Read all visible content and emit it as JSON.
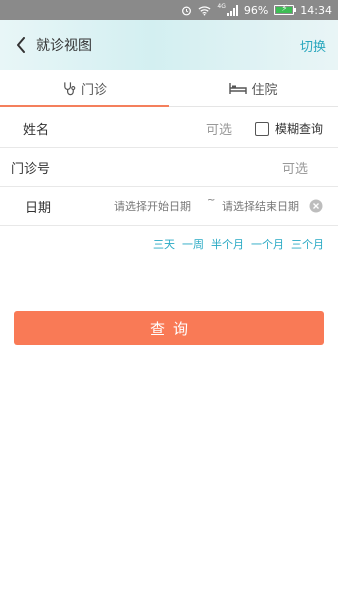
{
  "status_bar": {
    "battery_percent": "96%",
    "time": "14:34",
    "network_label": "4G",
    "battery_level": 0.96
  },
  "header": {
    "title": "就诊视图",
    "switch_label": "切换",
    "accent_color": "#29a7be"
  },
  "tabs": [
    {
      "label": "门诊",
      "icon": "stethoscope-icon",
      "active": true
    },
    {
      "label": "住院",
      "icon": "bed-icon",
      "active": false
    }
  ],
  "form": {
    "name": {
      "label": "姓名",
      "placeholder": "可选",
      "fuzzy_label": "模糊查询",
      "fuzzy_checked": false
    },
    "clinic_number": {
      "label": "门诊号",
      "placeholder": "可选"
    },
    "date": {
      "label": "日期",
      "start_placeholder": "请选择开始日期",
      "separator": "~",
      "end_placeholder": "请选择结束日期"
    }
  },
  "quick_ranges": [
    "三天",
    "一周",
    "半个月",
    "一个月",
    "三个月"
  ],
  "query_button": {
    "label": "查询",
    "color": "#f97a56"
  }
}
